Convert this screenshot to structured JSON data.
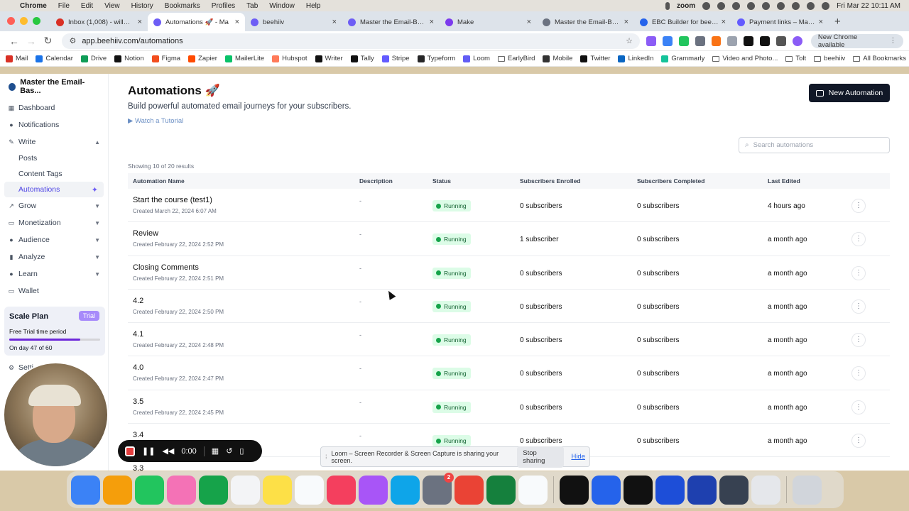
{
  "macos": {
    "menu": [
      "Chrome",
      "File",
      "Edit",
      "View",
      "History",
      "Bookmarks",
      "Profiles",
      "Tab",
      "Window",
      "Help"
    ],
    "zoom": "zoom",
    "clock": "Fri Mar 22  10:11 AM"
  },
  "tabs": [
    {
      "title": "Inbox (1,008) - will@em",
      "color": "#d93025",
      "active": false
    },
    {
      "title": "Automations 🚀 - Ma",
      "color": "#6d5df5",
      "active": true
    },
    {
      "title": "beehiiv",
      "color": "#6d5df5",
      "active": false
    },
    {
      "title": "Master the Email-Base",
      "color": "#6d5df5",
      "active": false
    },
    {
      "title": "Make",
      "color": "#7c3aed",
      "active": false
    },
    {
      "title": "Master the Email-Based",
      "color": "#6b7280",
      "active": false
    },
    {
      "title": "EBC Builder for beehiiv",
      "color": "#2563eb",
      "active": false
    },
    {
      "title": "Payment links – Master",
      "color": "#635bff",
      "active": false
    }
  ],
  "address": {
    "url": "app.beehiiv.com/automations",
    "new_chrome": "New Chrome available"
  },
  "bookmarks": [
    {
      "label": "Mail",
      "color": "#d93025"
    },
    {
      "label": "Calendar",
      "color": "#1a73e8"
    },
    {
      "label": "Drive",
      "color": "#0f9d58"
    },
    {
      "label": "Notion",
      "color": "#111111"
    },
    {
      "label": "Figma",
      "color": "#f24e1e"
    },
    {
      "label": "Zapier",
      "color": "#ff4a00"
    },
    {
      "label": "MailerLite",
      "color": "#09c269"
    },
    {
      "label": "Hubspot",
      "color": "#ff7a59"
    },
    {
      "label": "Writer",
      "color": "#111111"
    },
    {
      "label": "Tally",
      "color": "#111111"
    },
    {
      "label": "Stripe",
      "color": "#635bff"
    },
    {
      "label": "Typeform",
      "color": "#262627"
    },
    {
      "label": "Loom",
      "color": "#625df5"
    },
    {
      "label": "EarlyBird",
      "folder": true
    },
    {
      "label": "Mobile",
      "color": "#333333"
    },
    {
      "label": "Twitter",
      "color": "#111111"
    },
    {
      "label": "LinkedIn",
      "color": "#0a66c2"
    },
    {
      "label": "Grammarly",
      "color": "#15c39a"
    },
    {
      "label": "Video and Photo...",
      "folder": true
    },
    {
      "label": "Tolt",
      "folder": true
    },
    {
      "label": "beehiiv",
      "folder": true
    }
  ],
  "all_bookmarks": "All Bookmarks",
  "sidebar": {
    "publication": "Master the Email-Bas...",
    "items": [
      {
        "label": "Dashboard",
        "icon": "grid-icon"
      },
      {
        "label": "Notifications",
        "icon": "bell-icon"
      },
      {
        "label": "Write",
        "icon": "pencil-icon",
        "expanded": true
      }
    ],
    "write_sub": [
      {
        "label": "Posts"
      },
      {
        "label": "Content Tags"
      },
      {
        "label": "Automations",
        "active": true
      }
    ],
    "groups": [
      {
        "label": "Grow",
        "icon": "grow-icon"
      },
      {
        "label": "Monetization",
        "icon": "monetization-icon"
      },
      {
        "label": "Audience",
        "icon": "audience-icon"
      },
      {
        "label": "Analyze",
        "icon": "chart-icon"
      },
      {
        "label": "Learn",
        "icon": "bulb-icon"
      },
      {
        "label": "Wallet",
        "icon": "wallet-icon"
      }
    ],
    "plan": {
      "title": "Scale Plan",
      "badge": "Trial",
      "period": "Free Trial time period",
      "progress": 0.783,
      "day": "On day 47 of 60"
    },
    "settings": "Setti"
  },
  "page": {
    "title": "Automations 🚀",
    "subtitle": "Build powerful automated email journeys for your subscribers.",
    "tutorial": "Watch a Tutorial",
    "new_button": "New Automation",
    "search_placeholder": "Search automations",
    "showing": "Showing 10 of 20 results"
  },
  "table": {
    "headers": [
      "Automation Name",
      "Description",
      "Status",
      "Subscribers Enrolled",
      "Subscribers Completed",
      "Last Edited"
    ],
    "rows": [
      {
        "name": "Start the course (test1)",
        "created": "Created March 22, 2024 6:07 AM",
        "desc": "-",
        "status": "Running",
        "enrolled": "0 subscribers",
        "completed": "0 subscribers",
        "edited": "4 hours ago"
      },
      {
        "name": "Review",
        "created": "Created February 22, 2024 2:52 PM",
        "desc": "-",
        "status": "Running",
        "enrolled": "1 subscriber",
        "completed": "0 subscribers",
        "edited": "a month ago"
      },
      {
        "name": "Closing Comments",
        "created": "Created February 22, 2024 2:51 PM",
        "desc": "-",
        "status": "Running",
        "enrolled": "0 subscribers",
        "completed": "0 subscribers",
        "edited": "a month ago"
      },
      {
        "name": "4.2",
        "created": "Created February 22, 2024 2:50 PM",
        "desc": "-",
        "status": "Running",
        "enrolled": "0 subscribers",
        "completed": "0 subscribers",
        "edited": "a month ago"
      },
      {
        "name": "4.1",
        "created": "Created February 22, 2024 2:48 PM",
        "desc": "-",
        "status": "Running",
        "enrolled": "0 subscribers",
        "completed": "0 subscribers",
        "edited": "a month ago"
      },
      {
        "name": "4.0",
        "created": "Created February 22, 2024 2:47 PM",
        "desc": "-",
        "status": "Running",
        "enrolled": "0 subscribers",
        "completed": "0 subscribers",
        "edited": "a month ago"
      },
      {
        "name": "3.5",
        "created": "Created February 22, 2024 2:45 PM",
        "desc": "-",
        "status": "Running",
        "enrolled": "0 subscribers",
        "completed": "0 subscribers",
        "edited": "a month ago"
      },
      {
        "name": "3.4",
        "created": "",
        "desc": "-",
        "status": "Running",
        "enrolled": "0 subscribers",
        "completed": "0 subscribers",
        "edited": "a month ago"
      },
      {
        "name": "3.3",
        "created": "",
        "desc": "",
        "status": "",
        "enrolled": "",
        "completed": "",
        "edited": ""
      }
    ]
  },
  "loom": {
    "timer": "0:00",
    "share_text": "Loom – Screen Recorder & Screen Capture is sharing your screen.",
    "stop": "Stop sharing",
    "hide": "Hide"
  },
  "dock": [
    {
      "icon": "finder-icon",
      "color": "#3b82f6"
    },
    {
      "icon": "launchpad-icon",
      "color": "#f59e0b"
    },
    {
      "icon": "messages-icon",
      "color": "#22c55e"
    },
    {
      "icon": "photos-icon",
      "color": "#f472b6"
    },
    {
      "icon": "facetime-icon",
      "color": "#16a34a"
    },
    {
      "icon": "reminders-icon",
      "color": "#f3f4f6"
    },
    {
      "icon": "notes-icon",
      "color": "#fde047"
    },
    {
      "icon": "freeform-icon",
      "color": "#f8fafc"
    },
    {
      "icon": "music-icon",
      "color": "#f43f5e"
    },
    {
      "icon": "podcasts-icon",
      "color": "#a855f7"
    },
    {
      "icon": "appstore-icon",
      "color": "#0ea5e9"
    },
    {
      "icon": "settings-icon",
      "color": "#6b7280",
      "badge": "2"
    },
    {
      "icon": "chrome-icon",
      "color": "#ea4335"
    },
    {
      "icon": "excel-icon",
      "color": "#15803d"
    },
    {
      "icon": "slack-icon",
      "color": "#f8fafc"
    },
    {
      "icon": "capcut-icon",
      "color": "#111111"
    },
    {
      "icon": "zoom-icon",
      "color": "#2563eb"
    },
    {
      "icon": "spotify-icon",
      "color": "#111111"
    },
    {
      "icon": "onepassword-icon",
      "color": "#1d4ed8"
    },
    {
      "icon": "word-icon",
      "color": "#1e40af"
    },
    {
      "icon": "printer-icon",
      "color": "#374151"
    },
    {
      "icon": "preview-icon",
      "color": "#e5e7eb"
    },
    {
      "icon": "trash-icon",
      "color": "#d1d5db"
    }
  ]
}
